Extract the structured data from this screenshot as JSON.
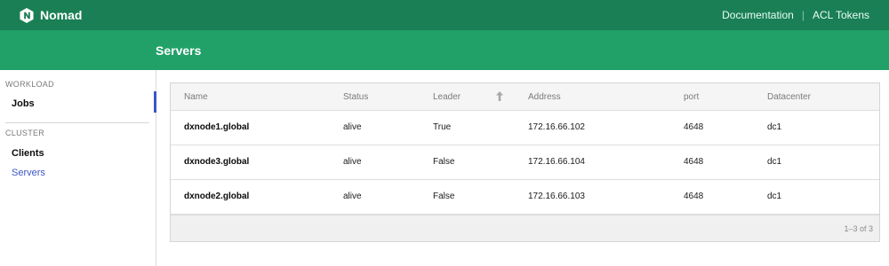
{
  "app": {
    "brand": "Nomad",
    "links": [
      "Documentation",
      "ACL Tokens"
    ],
    "colors": {
      "topbar": "#1a7f55",
      "subheader": "#21a168",
      "active": "#3c55c7"
    }
  },
  "page": {
    "title": "Servers"
  },
  "sidebar": {
    "sections": [
      {
        "label": "WORKLOAD",
        "items": [
          {
            "label": "Jobs",
            "active": false
          }
        ]
      },
      {
        "label": "CLUSTER",
        "items": [
          {
            "label": "Clients",
            "active": false
          },
          {
            "label": "Servers",
            "active": true
          }
        ]
      }
    ]
  },
  "table": {
    "columns": [
      "Name",
      "Status",
      "Leader",
      "Address",
      "port",
      "Datacenter"
    ],
    "sort_icon": "sort-ascending-icon",
    "rows": [
      {
        "name": "dxnode1.global",
        "status": "alive",
        "leader": "True",
        "address": "172.16.66.102",
        "port": "4648",
        "datacenter": "dc1"
      },
      {
        "name": "dxnode3.global",
        "status": "alive",
        "leader": "False",
        "address": "172.16.66.104",
        "port": "4648",
        "datacenter": "dc1"
      },
      {
        "name": "dxnode2.global",
        "status": "alive",
        "leader": "False",
        "address": "172.16.66.103",
        "port": "4648",
        "datacenter": "dc1"
      }
    ],
    "pagination": "1–3 of 3"
  }
}
